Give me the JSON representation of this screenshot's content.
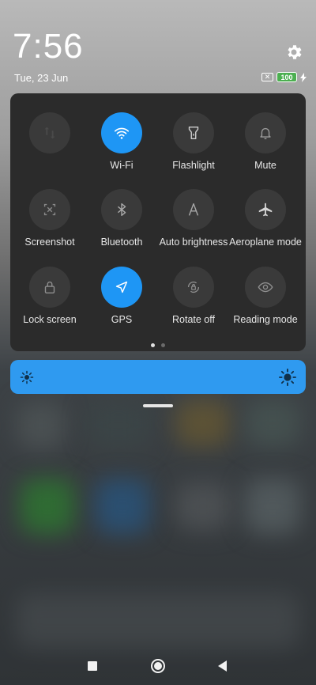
{
  "status": {
    "time": "7:56",
    "date": "Tue, 23 Jun",
    "battery_level": "100"
  },
  "quick_settings": {
    "tiles": [
      {
        "label": "",
        "icon": "mobile-data-icon",
        "active": false
      },
      {
        "label": "Wi-Fi",
        "icon": "wifi-icon",
        "active": true
      },
      {
        "label": "Flashlight",
        "icon": "flashlight-icon",
        "active": false
      },
      {
        "label": "Mute",
        "icon": "bell-icon",
        "active": false
      },
      {
        "label": "Screenshot",
        "icon": "screenshot-icon",
        "active": false
      },
      {
        "label": "Bluetooth",
        "icon": "bluetooth-icon",
        "active": false
      },
      {
        "label": "Auto brightness",
        "icon": "auto-brightness-icon",
        "active": false
      },
      {
        "label": "Aeroplane mode",
        "icon": "airplane-icon",
        "active": false
      },
      {
        "label": "Lock screen",
        "icon": "lock-icon",
        "active": false
      },
      {
        "label": "GPS",
        "icon": "location-arrow-icon",
        "active": true
      },
      {
        "label": "Rotate off",
        "icon": "rotate-lock-icon",
        "active": false
      },
      {
        "label": "Reading mode",
        "icon": "eye-icon",
        "active": false
      }
    ],
    "page_indicator": {
      "current": 1,
      "total": 2
    }
  },
  "brightness": {
    "accent": "#2f9af0"
  },
  "colors": {
    "active_tile": "#1e96f5",
    "inactive_tile": "#3a3a3a",
    "panel": "#2b2b2b",
    "battery": "#4caf50"
  }
}
